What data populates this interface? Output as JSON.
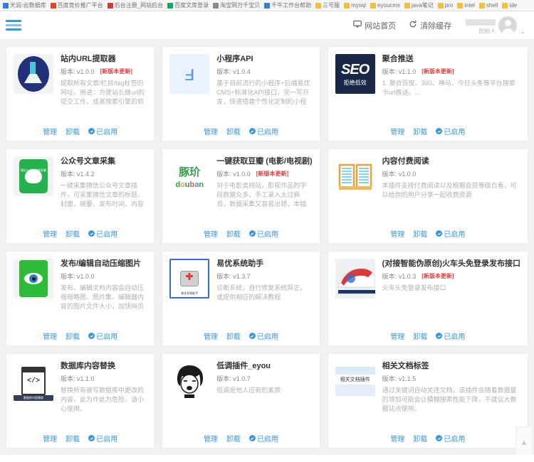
{
  "browser": {
    "bookmarks": [
      {
        "label": "天润-云数据库",
        "type": "site"
      },
      {
        "label": "百度竞价推广平台",
        "type": "site"
      },
      {
        "label": "后台注册_网站后台",
        "type": "site"
      },
      {
        "label": "百度文库登录",
        "type": "site"
      },
      {
        "label": "淘宝网万千宝贝",
        "type": "site"
      },
      {
        "label": "千牛工作台帮助",
        "type": "site"
      },
      {
        "label": "三号服",
        "type": "folder"
      },
      {
        "label": "mysql",
        "type": "folder"
      },
      {
        "label": "eyoucms",
        "type": "folder"
      },
      {
        "label": "java笔记",
        "type": "folder"
      },
      {
        "label": "pro",
        "type": "folder"
      },
      {
        "label": "intel",
        "type": "folder"
      },
      {
        "label": "shell",
        "type": "folder"
      },
      {
        "label": "ide",
        "type": "folder"
      }
    ]
  },
  "topbar": {
    "menu_icon": "hamburger-icon",
    "site_home_label": "网站首页",
    "clear_cache_label": "清除缓存",
    "user_role": "创始人",
    "caret": "⌄"
  },
  "card_actions": {
    "manage": "管理",
    "uninstall": "卸载",
    "enabled": "已启用"
  },
  "labels": {
    "version_prefix": "版本:",
    "new_version_badge": "[新版本更新]"
  },
  "plugins": [
    {
      "name": "站内URL提取器",
      "version": "v1.0.0",
      "has_update": true,
      "desc": "提取所有文章/栏目/tag标签的网址，用途：方便站长做url的提交工作，或者搜索引擎的抓取提交工作。",
      "logo": "flask-logo",
      "logo_caption": "",
      "status": "已启用"
    },
    {
      "name": "小程序API",
      "version": "v1.0.4",
      "has_update": false,
      "desc": "基于目前流行的小程序+后端易优CMS+标准化API接口，完一写开发，快速搭建个性化定制的小程序插件。",
      "logo": "mini-program-logo",
      "logo_caption": "",
      "status": "已启用"
    },
    {
      "name": "聚合推送",
      "version": "v1.1.0",
      "has_update": true,
      "desc": "1. 聚合百度、360、神马、今日头条等平台搜索卡url推送。...",
      "logo": "seo-logo",
      "logo_caption": "拒绝低效",
      "status": "已启用"
    },
    {
      "name": "公众号文章采集",
      "version": "v1.4.2",
      "has_update": false,
      "desc": "一键采集微信公众号文章插件，可采集微信文章的标题、封面、摘要、发布时间、内容图片可本地化，支...",
      "logo": "wechat-logo",
      "logo_caption": "微信公众号文章采集",
      "status": "已启用"
    },
    {
      "name": "一键获取豆瓣 (电影/电视剧)",
      "version": "v1.0.0",
      "has_update": true,
      "desc": "对于电影类网站，影视作品的字段数据众多，手工录入太过麻烦，数据采集又容易出错，本插件可帮您解决...",
      "logo": "douban-logo",
      "logo_caption": "",
      "status": "已启用"
    },
    {
      "name": "内容付费阅读",
      "version": "v1.0.0",
      "has_update": false,
      "desc": "本插件支持付费阅读以及根据会员等级白看，可以给你的用户分享一起收费资源",
      "logo": "book-logo",
      "logo_caption": "",
      "status": "已启用"
    },
    {
      "name": "发布/编辑自动压缩图片",
      "version": "v1.0.0",
      "has_update": false,
      "desc": "发布、编辑文档内容会自动压缩缩略图、图片集、编辑器内容的图片文件大小，加快网页的访问速度。",
      "logo": "eye-logo",
      "logo_caption": "",
      "status": "已启用"
    },
    {
      "name": "易优系统助手",
      "version": "v1.3.7",
      "has_update": false,
      "desc": "诊断系统，自行修复系统异正，或提供相应的解决教程",
      "logo": "toolkit-logo",
      "logo_caption": "易优系统助手",
      "status": "已启用"
    },
    {
      "name": "(对接智能伪原创)火车头免登录发布接口",
      "version": "v1.0.3",
      "has_update": true,
      "desc": "火车头免登录发布接口",
      "logo": "train-logo",
      "logo_caption": "",
      "status": "已启用"
    },
    {
      "name": "数据库内容替换",
      "version": "v1.1.0",
      "has_update": false,
      "desc": "替换所有被写数据库中更改的内容，此为作此为危险，请小心使用。",
      "logo": "database-logo",
      "logo_caption": "数据库内容替换",
      "status": "已启用"
    },
    {
      "name": "低调插件_eyou",
      "version": "v1.0.7",
      "has_update": false,
      "desc": "低调是他人应有的素质",
      "logo": "face-logo",
      "logo_caption": "",
      "status": "已启用"
    },
    {
      "name": "相关文档标签",
      "version": "v1.1.5",
      "has_update": false,
      "desc": "通过关键词自动关连文档，该插件会随着数据量的增加可能会让模糊搜索性能下降，不建议大数据站点使用。",
      "logo": "related-docs-logo",
      "logo_caption": "相关文档插件",
      "status": "已启用"
    }
  ],
  "scroll_to_top": {
    "icon": "chevron-up-icon"
  },
  "colors": {
    "accent": "#3598dc",
    "danger": "#e63c3c",
    "page_bg": "#f1f1f1",
    "card_bg": "#ffffff"
  }
}
